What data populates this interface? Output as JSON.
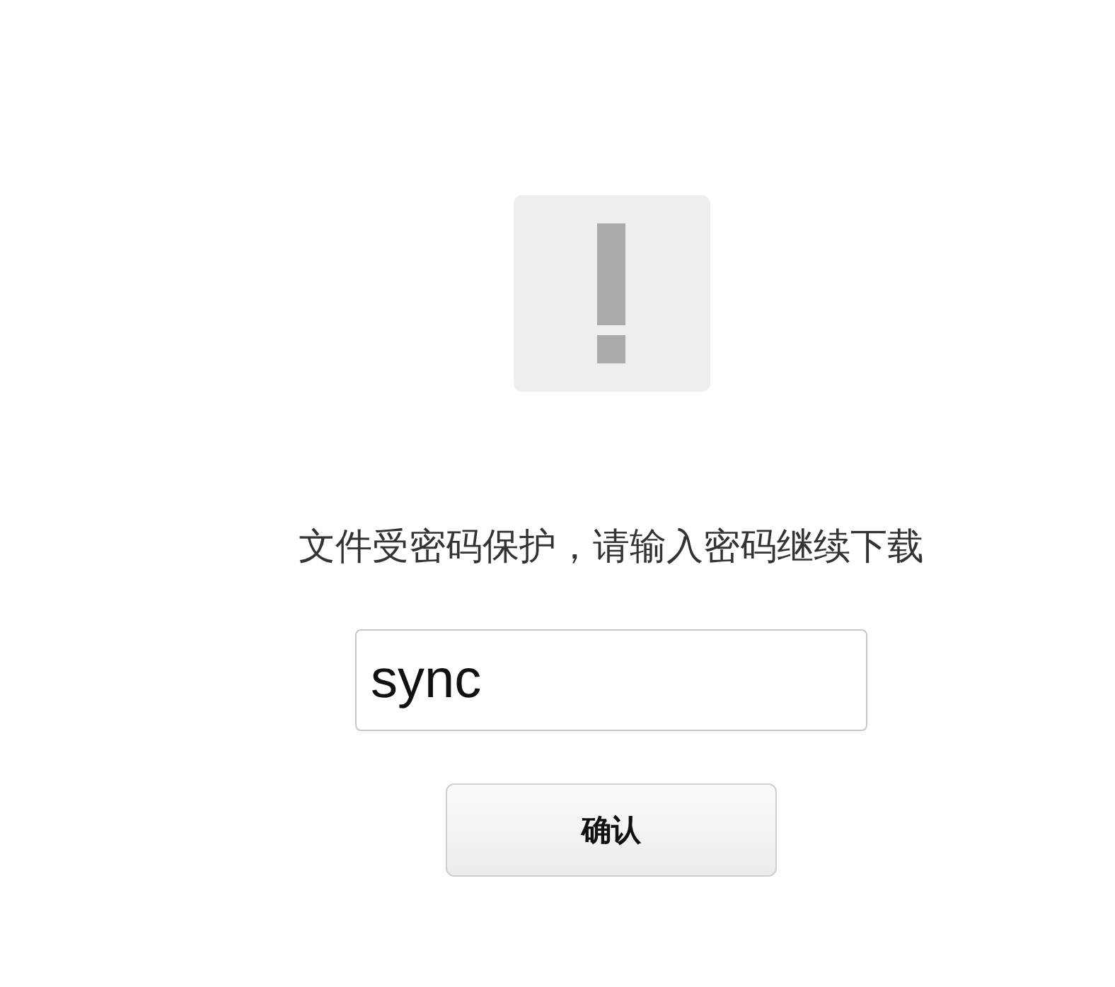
{
  "message": "文件受密码保护，请输入密码继续下载",
  "password_field": {
    "value": "sync"
  },
  "confirm_button": {
    "label": "确认"
  }
}
